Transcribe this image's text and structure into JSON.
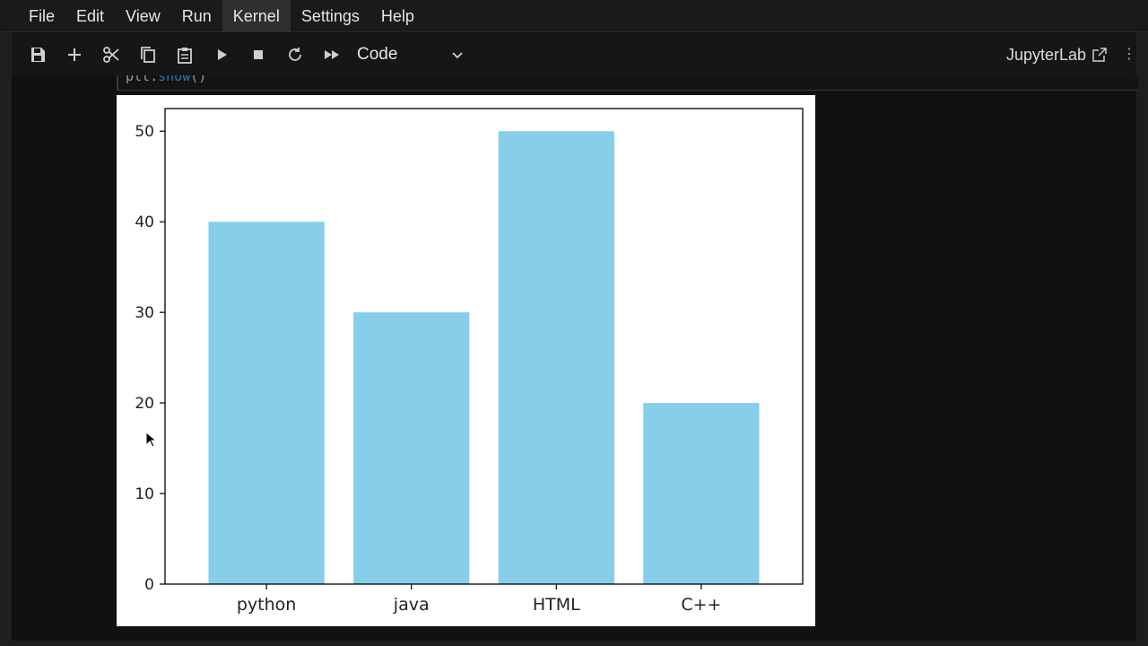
{
  "menu": {
    "items": [
      {
        "label": "File"
      },
      {
        "label": "Edit"
      },
      {
        "label": "View"
      },
      {
        "label": "Run"
      },
      {
        "label": "Kernel"
      },
      {
        "label": "Settings"
      },
      {
        "label": "Help"
      }
    ],
    "active": "Kernel"
  },
  "toolbar": {
    "buttons": [
      {
        "name": "save-icon"
      },
      {
        "name": "plus-icon"
      },
      {
        "name": "cut-icon"
      },
      {
        "name": "copy-icon"
      },
      {
        "name": "paste-icon"
      },
      {
        "name": "run-icon"
      },
      {
        "name": "stop-icon"
      },
      {
        "name": "restart-icon"
      },
      {
        "name": "fast-forward-icon"
      }
    ],
    "cell_type": "Code",
    "kernel_label": "JupyterLab"
  },
  "cell": {
    "code_fragment_object": "plt.",
    "code_fragment_method": "show",
    "code_fragment_tail": "()"
  },
  "chart_data": {
    "type": "bar",
    "categories": [
      "python",
      "java",
      "HTML",
      "C++"
    ],
    "values": [
      40,
      30,
      50,
      20
    ],
    "title": "",
    "xlabel": "",
    "ylabel": "",
    "ylim": [
      0,
      52.5
    ],
    "yticks": [
      0,
      10,
      20,
      30,
      40,
      50
    ],
    "bar_color": "#87ceeb",
    "grid": false,
    "legend": false
  },
  "colors": {
    "background": "#111111",
    "menubar": "#1a1a1a",
    "bar": "#87ceeb"
  }
}
